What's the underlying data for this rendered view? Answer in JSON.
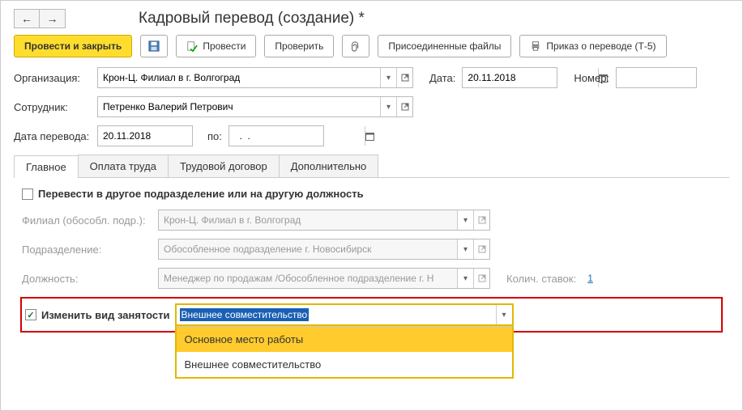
{
  "nav": {
    "back": "←",
    "forward": "→"
  },
  "title": "Кадровый перевод (создание) *",
  "toolbar": {
    "post_close": "Провести и закрыть",
    "post": "Провести",
    "check": "Проверить",
    "attached": "Присоединенные файлы",
    "order": "Приказ о переводе (Т-5)"
  },
  "fields": {
    "org_label": "Организация:",
    "org_value": "Крон-Ц. Филиал в г. Волгоград",
    "date_label": "Дата:",
    "date_value": "20.11.2018",
    "number_label": "Номер:",
    "number_value": "",
    "employee_label": "Сотрудник:",
    "employee_value": "Петренко Валерий Петрович",
    "transfer_date_label": "Дата перевода:",
    "transfer_date_value": "20.11.2018",
    "to_label": "по:",
    "to_value": "  .  .    "
  },
  "tabs": {
    "main": "Главное",
    "pay": "Оплата труда",
    "contract": "Трудовой договор",
    "extra": "Дополнительно"
  },
  "main_tab": {
    "move_checkbox": "Перевести в другое подразделение или на другую должность",
    "branch_label": "Филиал (обособл. подр.):",
    "branch_value": "Крон-Ц. Филиал в г. Волгоград",
    "dept_label": "Подразделение:",
    "dept_value": "Обособленное подразделение г. Новосибирск",
    "position_label": "Должность:",
    "position_value": "Менеджер по продажам /Обособленное подразделение г. Н",
    "rates_label": "Колич. ставок:",
    "rates_value": "1",
    "change_emp_type": "Изменить вид занятости",
    "emp_type_selected": "Внешнее совместительство",
    "emp_type_options": [
      "Основное место работы",
      "Внешнее совместительство"
    ]
  }
}
